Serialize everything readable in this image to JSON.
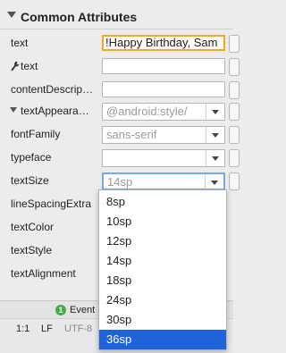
{
  "section": {
    "title": "Common Attributes"
  },
  "rows": {
    "text": {
      "label": "text",
      "value": "Happy Birthday, Sam!"
    },
    "tools_text": {
      "label": "text",
      "value": ""
    },
    "content_description": {
      "label": "contentDescrip…",
      "value": ""
    },
    "text_appearance": {
      "label": "textAppeara…",
      "value": "@android:style/"
    },
    "font_family": {
      "label": "fontFamily",
      "value": "sans-serif"
    },
    "typeface": {
      "label": "typeface",
      "value": ""
    },
    "text_size": {
      "label": "textSize",
      "value": "14sp"
    },
    "line_spacing_extra": {
      "label": "lineSpacingExtra"
    },
    "text_color": {
      "label": "textColor"
    },
    "text_style": {
      "label": "textStyle"
    },
    "text_alignment": {
      "label": "textAlignment"
    }
  },
  "dropdown": {
    "options": [
      "8sp",
      "10sp",
      "12sp",
      "14sp",
      "18sp",
      "24sp",
      "30sp",
      "36sp"
    ],
    "selected": "36sp"
  },
  "tabs": {
    "event_badge": "1",
    "event_label": "Event"
  },
  "status": {
    "position": "1:1",
    "line_ending": "LF",
    "encoding": "UTF-8"
  },
  "colors": {
    "focus": "#f5a623",
    "selection": "#1e64d8",
    "badge": "#48a948"
  },
  "icons": [
    "chevron-down-icon",
    "wrench-icon",
    "dropdown-arrow-icon",
    "event-badge-icon"
  ]
}
